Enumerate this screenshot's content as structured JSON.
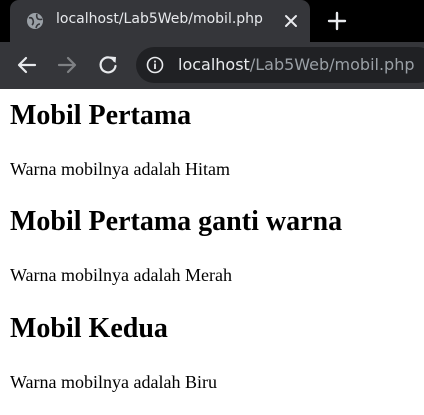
{
  "browser": {
    "tab_title": "localhost/Lab5Web/mobil.php",
    "url_host": "localhost",
    "url_path": "/Lab5Web/mobil.php"
  },
  "page": {
    "sections": [
      {
        "heading": "Mobil Pertama",
        "text": "Warna mobilnya adalah Hitam"
      },
      {
        "heading": "Mobil Pertama ganti warna",
        "text": "Warna mobilnya adalah Merah"
      },
      {
        "heading": "Mobil Kedua",
        "text": "Warna mobilnya adalah Biru"
      }
    ]
  },
  "colors": {
    "chrome_dark": "#202124",
    "tab_active": "#35363a",
    "chrome_text": "#e8eaed",
    "url_dim": "#9aa0a6"
  },
  "icons": {
    "tab_favicon": "globe-icon",
    "tab_close": "close-icon",
    "new_tab": "plus-icon",
    "back": "back-arrow-icon",
    "forward": "forward-arrow-icon",
    "reload": "reload-icon",
    "site_info": "info-icon"
  }
}
